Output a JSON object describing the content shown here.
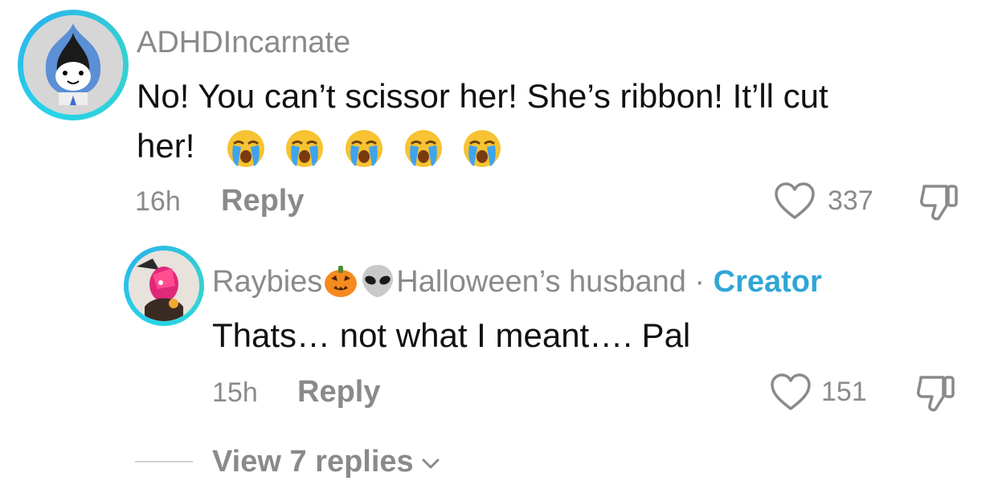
{
  "comments": [
    {
      "username": "ADHDIncarnate",
      "text_line1": "No! You can’t scissor her! She’s ribbon! It’ll cut",
      "text_line2": "her!",
      "emojis": [
        "loudly-crying-face",
        "loudly-crying-face",
        "loudly-crying-face",
        "loudly-crying-face",
        "loudly-crying-face"
      ],
      "time": "16h",
      "reply_label": "Reply",
      "likes": "337"
    }
  ],
  "reply": {
    "username_prefix": "Raybies",
    "username_suffix": "Halloween’s husband",
    "separator": "·",
    "creator_label": "Creator",
    "username_emojis": [
      "jack-o-lantern",
      "alien"
    ],
    "text": "Thats… not what I meant…. Pal",
    "time": "15h",
    "reply_label": "Reply",
    "likes": "151"
  },
  "view_replies": {
    "label": "View 7 replies"
  },
  "colors": {
    "muted": "#8a8a8a",
    "creator": "#2fa6d6",
    "ring": "#27d3e8"
  }
}
